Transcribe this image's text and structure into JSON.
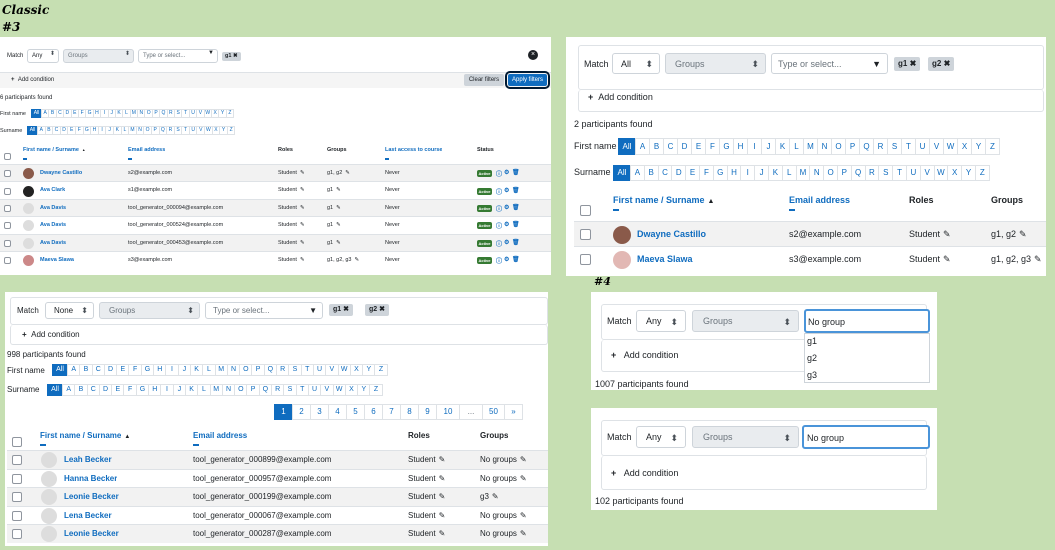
{
  "labels": {
    "classic": "Classic",
    "n3": "#3",
    "n4": "#4"
  },
  "icons": {
    "close": "close-icon",
    "plus": "plus-icon",
    "pencil": "pencil-icon",
    "remove": "remove-icon",
    "info": "info-icon",
    "gear": "gear-icon",
    "trash": "trash-icon",
    "sort": "sort-asc-icon"
  },
  "common": {
    "match": "Match",
    "add_condition": "Add condition",
    "groups": "Groups",
    "type_or_select": "Type or select...",
    "first_name": "First name",
    "surname": "Surname",
    "all": "All",
    "letters": [
      "A",
      "B",
      "C",
      "D",
      "E",
      "F",
      "G",
      "H",
      "I",
      "J",
      "K",
      "L",
      "M",
      "N",
      "O",
      "P",
      "Q",
      "R",
      "S",
      "T",
      "U",
      "V",
      "W",
      "X",
      "Y",
      "Z"
    ],
    "col_name": "First name / Surname",
    "col_email": "Email address",
    "col_roles": "Roles",
    "col_groups": "Groups",
    "col_last_access": "Last access to course",
    "col_status": "Status",
    "student": "Student",
    "never": "Never",
    "active": "Active",
    "no_group": "No group"
  },
  "p1": {
    "match_value": "Any",
    "pills": [
      "g1"
    ],
    "clear_label": "Clear filters",
    "apply_label": "Apply filters",
    "count": "6 participants found",
    "rows": [
      {
        "name": "Dwayne Castillo",
        "email": "s2@example.com",
        "role": "Student",
        "groups": "g1, g2",
        "access": "Never",
        "status": "Active"
      },
      {
        "name": "Ava Clark",
        "email": "s1@example.com",
        "role": "Student",
        "groups": "g1",
        "access": "Never",
        "status": "Active"
      },
      {
        "name": "Ava Davis",
        "email": "tool_generator_000094@example.com",
        "role": "Student",
        "groups": "g1",
        "access": "Never",
        "status": "Active"
      },
      {
        "name": "Ava Davis",
        "email": "tool_generator_000524@example.com",
        "role": "Student",
        "groups": "g1",
        "access": "Never",
        "status": "Active"
      },
      {
        "name": "Ava Davis",
        "email": "tool_generator_000453@example.com",
        "role": "Student",
        "groups": "g1",
        "access": "Never",
        "status": "Active"
      },
      {
        "name": "Maeva Slawa",
        "email": "s3@example.com",
        "role": "Student",
        "groups": "g1, g2, g3",
        "access": "Never",
        "status": "Active"
      }
    ]
  },
  "p2": {
    "match_value": "All",
    "pills": [
      "g1",
      "g2"
    ],
    "count": "2 participants found",
    "rows": [
      {
        "name": "Dwayne Castillo",
        "email": "s2@example.com",
        "role": "Student",
        "groups": "g1, g2"
      },
      {
        "name": "Maeva Slawa",
        "email": "s3@example.com",
        "role": "Student",
        "groups": "g1, g2, g3"
      }
    ]
  },
  "p3": {
    "match_value": "None",
    "pills": [
      "g1",
      "g2"
    ],
    "count": "998 participants found",
    "pages": [
      "1",
      "2",
      "3",
      "4",
      "5",
      "6",
      "7",
      "8",
      "9",
      "10",
      "...",
      "50",
      "»"
    ],
    "rows": [
      {
        "name": "Leah Becker",
        "email": "tool_generator_000899@example.com",
        "role": "Student",
        "groups": "No groups"
      },
      {
        "name": "Hanna Becker",
        "email": "tool_generator_000957@example.com",
        "role": "Student",
        "groups": "No groups"
      },
      {
        "name": "Leonie Becker",
        "email": "tool_generator_000199@example.com",
        "role": "Student",
        "groups": "g3"
      },
      {
        "name": "Lena Becker",
        "email": "tool_generator_000067@example.com",
        "role": "Student",
        "groups": "No groups"
      },
      {
        "name": "Leonie Becker",
        "email": "tool_generator_000287@example.com",
        "role": "Student",
        "groups": "No groups"
      }
    ]
  },
  "p4": {
    "match_value": "Any",
    "input_value": "No group",
    "options": [
      "No group",
      "g1",
      "g2",
      "g3"
    ],
    "count": "1007 participants found"
  },
  "p5": {
    "match_value": "Any",
    "input_value": "No group",
    "count": "102 participants found"
  },
  "colors": {
    "accent": "#0f6cbf",
    "active_badge": "#357a32",
    "background": "#c6dfb2",
    "pill": "#ced4da"
  }
}
